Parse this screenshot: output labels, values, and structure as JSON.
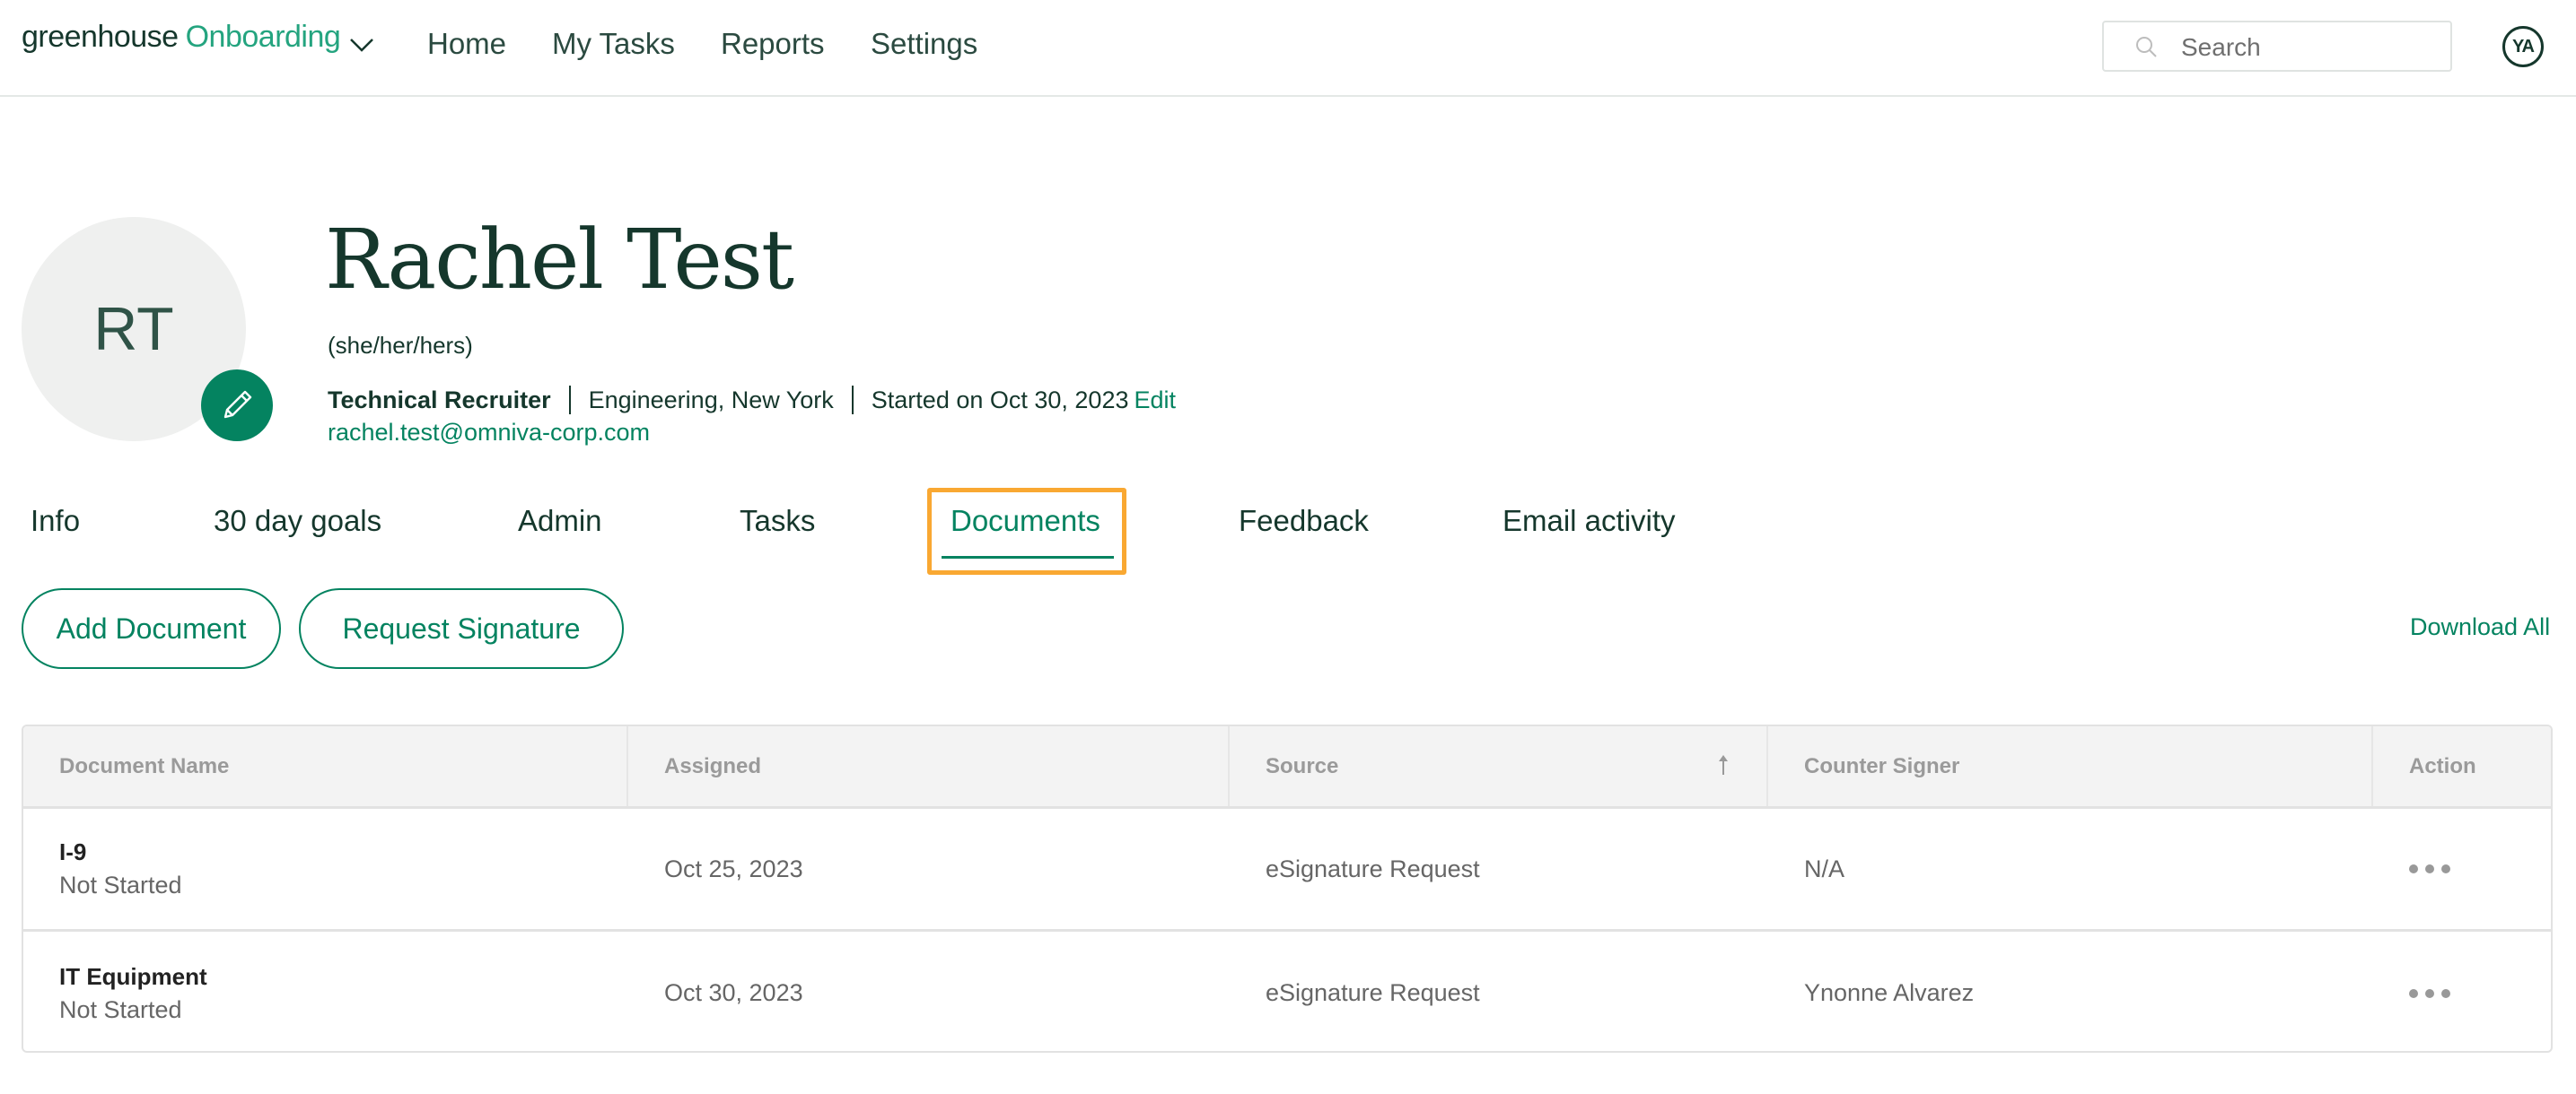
{
  "header": {
    "logo_primary": "greenhouse",
    "logo_secondary": "Onboarding",
    "nav": [
      {
        "label": "Home"
      },
      {
        "label": "My Tasks"
      },
      {
        "label": "Reports"
      },
      {
        "label": "Settings"
      }
    ],
    "search": {
      "placeholder": "Search",
      "value": ""
    },
    "user_initials": "YA"
  },
  "profile": {
    "initials": "RT",
    "name": "Rachel Test",
    "pronouns": "(she/her/hers)",
    "job_title": "Technical Recruiter",
    "department_location": "Engineering, New York",
    "start_text": "Started on Oct 30, 2023",
    "edit_label": "Edit",
    "email": "rachel.test@omniva-corp.com"
  },
  "tabs": [
    {
      "label": "Info",
      "active": false
    },
    {
      "label": "30 day goals",
      "active": false
    },
    {
      "label": "Admin",
      "active": false
    },
    {
      "label": "Tasks",
      "active": false
    },
    {
      "label": "Documents",
      "active": true
    },
    {
      "label": "Feedback",
      "active": false
    },
    {
      "label": "Email activity",
      "active": false
    }
  ],
  "actions": {
    "add_document": "Add Document",
    "request_signature": "Request Signature",
    "download_all": "Download All"
  },
  "table": {
    "columns": [
      "Document Name",
      "Assigned",
      "Source",
      "Counter Signer",
      "Action"
    ],
    "sorted_column": "Source",
    "sort_direction": "ascending",
    "rows": [
      {
        "name": "I-9",
        "status": "Not Started",
        "assigned": "Oct 25, 2023",
        "source": "eSignature Request",
        "counter_signer": "N/A"
      },
      {
        "name": "IT Equipment",
        "status": "Not Started",
        "assigned": "Oct 30, 2023",
        "source": "eSignature Request",
        "counter_signer": "Ynonne Alvarez"
      }
    ]
  },
  "colors": {
    "brand_dark": "#15372c",
    "brand_green": "#048360",
    "logo_green": "#24a47f",
    "focus_orange": "#f9a832"
  }
}
